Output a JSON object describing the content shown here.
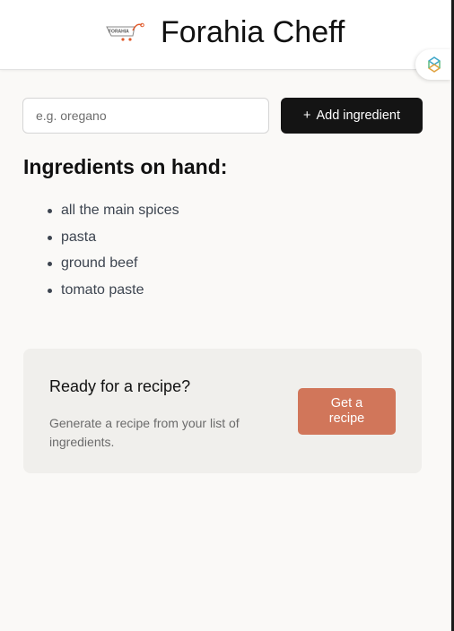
{
  "header": {
    "title": "Forahia Cheff",
    "logo_text": "FORAHIA"
  },
  "ingredient_form": {
    "placeholder": "e.g. oregano",
    "value": "",
    "add_icon": "+",
    "add_label": "Add ingredient"
  },
  "ingredients": {
    "heading": "Ingredients on hand:",
    "items": [
      "all the main spices",
      "pasta",
      "ground beef",
      "tomato paste"
    ]
  },
  "recipe_card": {
    "title": "Ready for a recipe?",
    "description": "Generate a recipe from your list of ingredients.",
    "button_label": "Get a recipe"
  },
  "icons": {
    "logo": "cart-logo-icon",
    "extension": "extension-icon",
    "add": "plus-icon"
  },
  "colors": {
    "page_background": "#faf9f7",
    "header_background": "#ffffff",
    "add_button": "#141414",
    "recipe_card": "#f0efec",
    "recipe_button": "#d1765a",
    "logo_accent": "#e05a2b"
  }
}
